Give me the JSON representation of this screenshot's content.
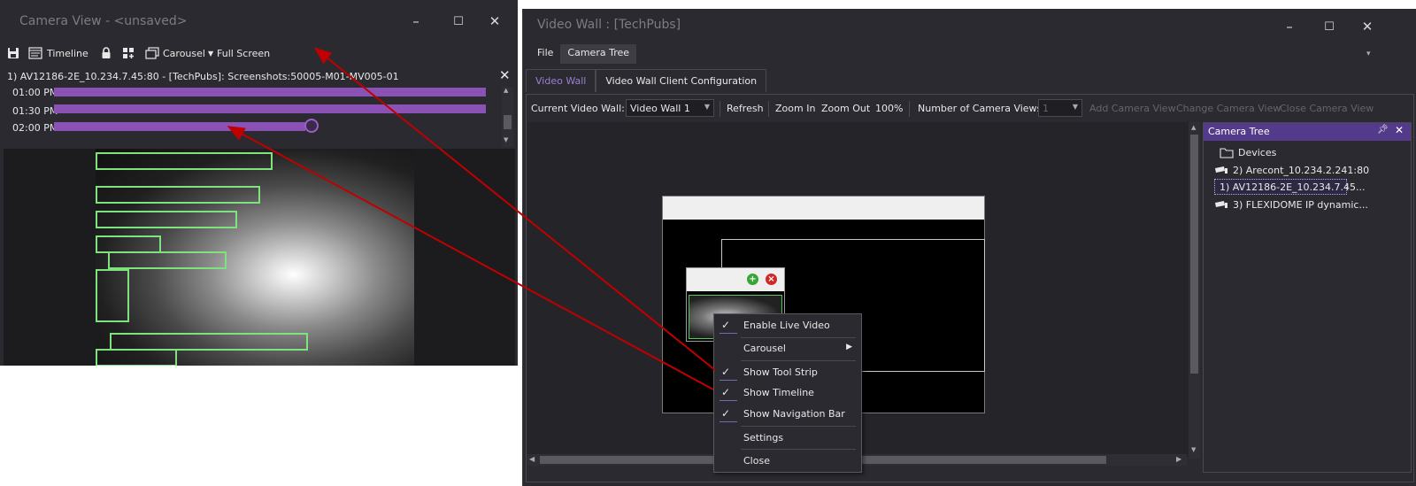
{
  "camera_view": {
    "title": "Camera View - <unsaved>",
    "window_buttons": {
      "minimize": "–",
      "maximize": "☐",
      "close": "✕"
    },
    "toolbar": {
      "timeline_label": "Timeline",
      "carousel_label": "Carousel",
      "full_screen_label": "Full Screen"
    },
    "camera_name": "1) AV12186-2E_10.234.7.45:80 - [TechPubs]: Screenshots:50005-M01-MV005-01",
    "close_label": "✕",
    "timeline": {
      "rows": [
        {
          "time": "01:00 PM"
        },
        {
          "time": "01:30 PM"
        },
        {
          "time": "02:00 PM"
        }
      ]
    }
  },
  "video_wall": {
    "title": "Video Wall : [TechPubs]",
    "window_buttons": {
      "minimize": "–",
      "maximize": "☐",
      "close": "✕"
    },
    "menu": {
      "file": "File",
      "camera_tree": "Camera Tree"
    },
    "tabs": {
      "video_wall": "Video Wall",
      "client_config": "Video Wall Client Configuration"
    },
    "toolbar": {
      "current_video_wall_label": "Current Video Wall:",
      "current_video_wall_value": "Video Wall 1",
      "refresh": "Refresh",
      "zoom_in": "Zoom In",
      "zoom_out": "Zoom Out",
      "zoom_level": "100%",
      "num_camera_views_label": "Number of Camera Views",
      "num_camera_views_value": "1",
      "add_camera_view": "Add Camera View",
      "change_camera_view": "Change Camera View",
      "close_camera_view": "Close Camera View"
    }
  },
  "camera_tree": {
    "title": "Camera Tree",
    "items": [
      {
        "label": "Devices"
      },
      {
        "label": "2) Arecont_10.234.2.241:80"
      },
      {
        "label": "1) AV12186-2E_10.234.7.45..."
      },
      {
        "label": "3) FLEXIDOME IP dynamic..."
      }
    ]
  },
  "context_menu": {
    "items": [
      {
        "label": "Enable Live Video",
        "checked": true
      },
      {
        "label": "Carousel",
        "submenu": true
      },
      {
        "label": "Show Tool Strip",
        "checked": true
      },
      {
        "label": "Show Timeline",
        "checked": true
      },
      {
        "label": "Show Navigation Bar",
        "checked": true
      },
      {
        "label": "Settings"
      },
      {
        "label": "Close"
      }
    ]
  },
  "colors": {
    "accent_purple": "#8b52b5",
    "tree_header": "#533a8a",
    "annotation_arrow": "#c00000",
    "motion_box": "#7ee37e"
  },
  "icons": [
    "save-icon",
    "timeline-icon",
    "lock-icon",
    "layout-icon",
    "carousel-icon",
    "folder-icon",
    "camera-icon",
    "pin-icon",
    "check-icon",
    "add-icon",
    "remove-icon"
  ]
}
